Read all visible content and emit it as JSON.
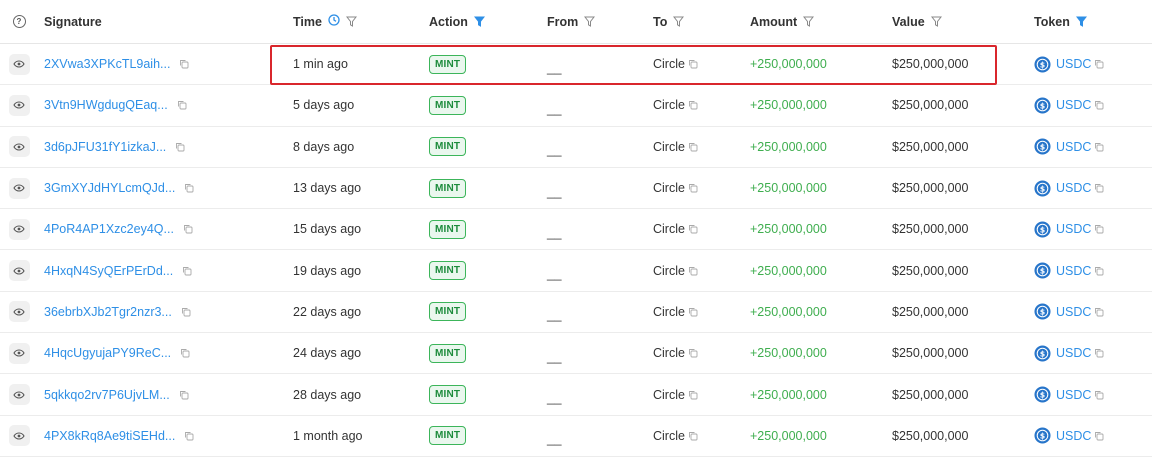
{
  "headers": {
    "signature": "Signature",
    "time": "Time",
    "action": "Action",
    "from": "From",
    "to": "To",
    "amount": "Amount",
    "value": "Value",
    "token": "Token"
  },
  "colors": {
    "link": "#2e8fe6",
    "amount_positive": "#3fae4f",
    "mint_badge": "#3cb55a",
    "highlight": "#d9262c"
  },
  "icons": {
    "help": "question-circle-icon",
    "eye": "eye-icon",
    "filter": "filter-icon",
    "clock": "clock-icon",
    "copy": "copy-icon",
    "token": "usdc-icon"
  },
  "rows": [
    {
      "signature": "2XVwa3XPKcTL9aih...",
      "time": "1 min ago",
      "action": "MINT",
      "from": "__",
      "to": "Circle",
      "amount": "+250,000,000",
      "value": "$250,000,000",
      "token": "USDC"
    },
    {
      "signature": "3Vtn9HWgdugQEaq...",
      "time": "5 days ago",
      "action": "MINT",
      "from": "__",
      "to": "Circle",
      "amount": "+250,000,000",
      "value": "$250,000,000",
      "token": "USDC"
    },
    {
      "signature": "3d6pJFU31fY1izkaJ...",
      "time": "8 days ago",
      "action": "MINT",
      "from": "__",
      "to": "Circle",
      "amount": "+250,000,000",
      "value": "$250,000,000",
      "token": "USDC"
    },
    {
      "signature": "3GmXYJdHYLcmQJd...",
      "time": "13 days ago",
      "action": "MINT",
      "from": "__",
      "to": "Circle",
      "amount": "+250,000,000",
      "value": "$250,000,000",
      "token": "USDC"
    },
    {
      "signature": "4PoR4AP1Xzc2ey4Q...",
      "time": "15 days ago",
      "action": "MINT",
      "from": "__",
      "to": "Circle",
      "amount": "+250,000,000",
      "value": "$250,000,000",
      "token": "USDC"
    },
    {
      "signature": "4HxqN4SyQErPErDd...",
      "time": "19 days ago",
      "action": "MINT",
      "from": "__",
      "to": "Circle",
      "amount": "+250,000,000",
      "value": "$250,000,000",
      "token": "USDC"
    },
    {
      "signature": "36ebrbXJb2Tgr2nzr3...",
      "time": "22 days ago",
      "action": "MINT",
      "from": "__",
      "to": "Circle",
      "amount": "+250,000,000",
      "value": "$250,000,000",
      "token": "USDC"
    },
    {
      "signature": "4HqcUgyujaPY9ReC...",
      "time": "24 days ago",
      "action": "MINT",
      "from": "__",
      "to": "Circle",
      "amount": "+250,000,000",
      "value": "$250,000,000",
      "token": "USDC"
    },
    {
      "signature": "5qkkqo2rv7P6UjvLM...",
      "time": "28 days ago",
      "action": "MINT",
      "from": "__",
      "to": "Circle",
      "amount": "+250,000,000",
      "value": "$250,000,000",
      "token": "USDC"
    },
    {
      "signature": "4PX8kRq8Ae9tiSEHd...",
      "time": "1 month ago",
      "action": "MINT",
      "from": "__",
      "to": "Circle",
      "amount": "+250,000,000",
      "value": "$250,000,000",
      "token": "USDC"
    }
  ]
}
